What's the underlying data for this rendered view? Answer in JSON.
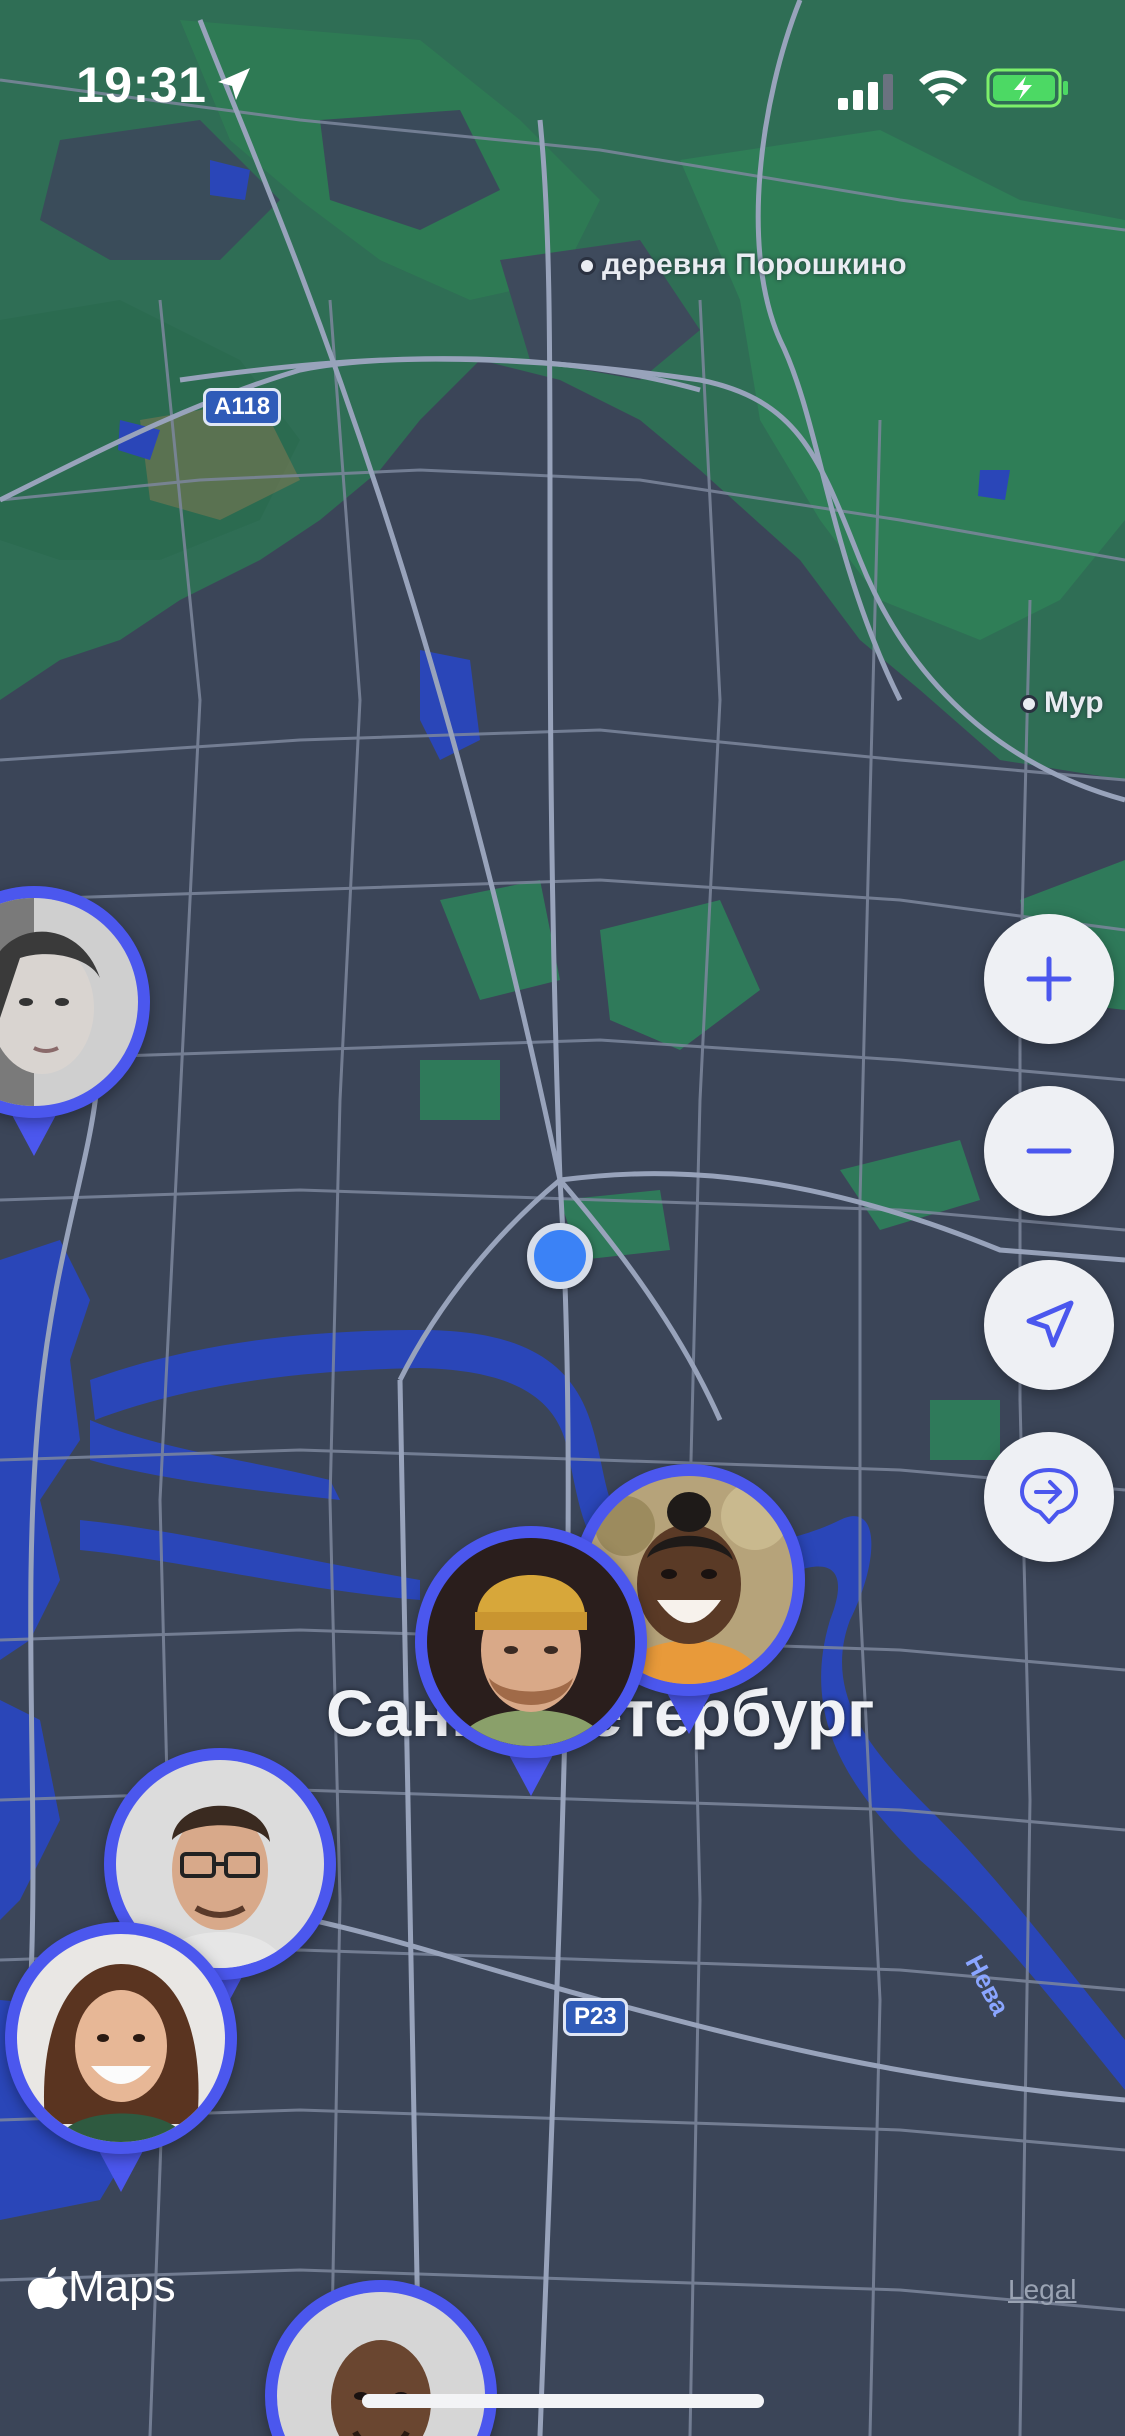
{
  "status_bar": {
    "time": "19:31",
    "icons": [
      "location-arrow-icon",
      "cellular-signal-icon",
      "wifi-icon",
      "battery-charging-icon"
    ]
  },
  "map": {
    "places": {
      "village": "деревня Порошкино",
      "murino": "Мур",
      "city": "Санкт-Петербург"
    },
    "roads": {
      "a118": "A118",
      "r23": "P23"
    },
    "river": "Нева"
  },
  "controls": {
    "zoom_in": "plus-icon",
    "zoom_out": "minus-icon",
    "locate": "navigation-arrow-icon",
    "route": "route-pin-icon"
  },
  "attribution": {
    "maps": "Maps",
    "legal": "Legal"
  },
  "friends": [
    {
      "name": "friend-woman-bw"
    },
    {
      "name": "friend-man-beanie"
    },
    {
      "name": "friend-woman-smiling"
    },
    {
      "name": "friend-man-glasses"
    },
    {
      "name": "friend-woman-curly"
    },
    {
      "name": "friend-man-bald"
    }
  ],
  "colors": {
    "map_background": "#3b4558",
    "park": "#2f7a5a",
    "water": "#2a46b8",
    "road": "#7d879d",
    "pin_ring": "#4b57ee",
    "user_location": "#3b82f6",
    "control_bg": "#eef0f4",
    "control_icon": "#4b57ee"
  }
}
